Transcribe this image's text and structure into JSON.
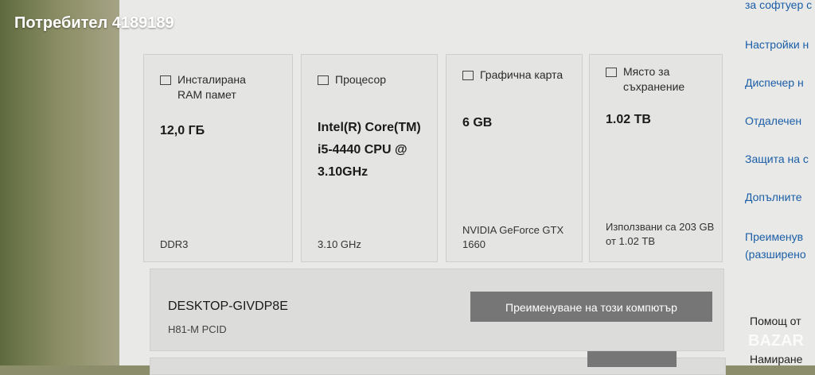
{
  "watermark": "Потребител 4189189",
  "cards": {
    "ram": {
      "title": "Инсталирана RAM памет",
      "value": "12,0 ГБ",
      "sub": "DDR3",
      "icon": "ram-icon"
    },
    "cpu": {
      "title": "Процесор",
      "value": "Intel(R) Core(TM) i5-4440 CPU @ 3.10GHz",
      "sub": "3.10 GHz",
      "icon": "cpu-icon"
    },
    "gpu": {
      "title": "Графична карта",
      "value": "6 GB",
      "sub": "NVIDIA GeForce GTX 1660",
      "icon": "gpu-icon"
    },
    "storage": {
      "title": "Място за съхранение",
      "value": "1.02 TB",
      "sub": "Използвани са 203 GB от 1.02 TB",
      "icon": "storage-icon"
    }
  },
  "device": {
    "name": "DESKTOP-GIVDP8E",
    "model": "H81-M PCID",
    "rename_label": "Преименуване на този компютър"
  },
  "sidebar": {
    "links": [
      "за софтуер с",
      "Настройки н",
      "Диспечер н",
      "Отдалечен",
      "Защита на с",
      "Допълните",
      "Преименув",
      "(разширено"
    ],
    "help": "Помощ от",
    "find": "Намиране"
  },
  "logo": "BAZAR"
}
